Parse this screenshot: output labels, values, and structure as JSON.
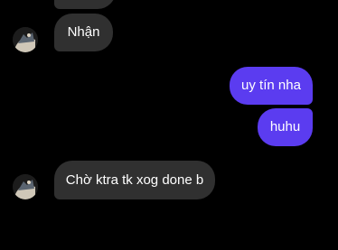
{
  "chat": {
    "messages": [
      {
        "id": "m0",
        "direction": "incoming",
        "text": ""
      },
      {
        "id": "m1",
        "direction": "incoming",
        "text": "Nhận"
      },
      {
        "id": "m2",
        "direction": "outgoing",
        "text": "uy tín nha"
      },
      {
        "id": "m3",
        "direction": "outgoing",
        "text": "huhu"
      },
      {
        "id": "m4",
        "direction": "incoming",
        "text": "Chờ ktra tk xog done b"
      },
      {
        "id": "m5",
        "direction": "outgoing",
        "text": "😭😭"
      }
    ],
    "contact_avatar_icon": "contact-avatar-icon"
  },
  "colors": {
    "background": "#000000",
    "incoming_bubble": "#303030",
    "outgoing_bubble": "#5b3cf0",
    "text": "#ffffff"
  }
}
